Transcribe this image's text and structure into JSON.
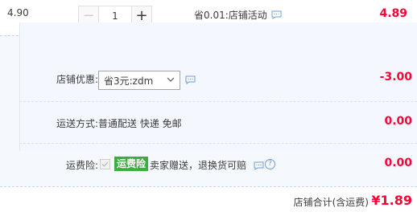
{
  "top_row": {
    "unit_price": "4.90",
    "quantity": "1",
    "minus_symbol": "−",
    "plus_symbol": "+",
    "promo": "省0.01:店铺活动",
    "subtotal": "4.89"
  },
  "coupon": {
    "label": "店铺优惠:",
    "selected": "省3元:zdm",
    "amount": "-3.00"
  },
  "shipping": {
    "label": "运送方式:",
    "options": "普通配送 快递 免邮",
    "amount": "0.00"
  },
  "insurance": {
    "label": "运费险:",
    "tag": "运费险",
    "description": "卖家赠送，退换货可赔",
    "help_symbol": "?",
    "amount": "0.00"
  },
  "footer": {
    "total_label": "店铺合计(含运费)",
    "total_value": "¥1.89"
  },
  "colors": {
    "price_red": "#ff0036",
    "panel_bg": "#f5f8fd",
    "tag_green": "#3dad3f",
    "icon_blue": "#6d9fd6"
  },
  "icons": [
    "message-icon",
    "chevron-down-icon",
    "check-icon",
    "help-icon"
  ]
}
